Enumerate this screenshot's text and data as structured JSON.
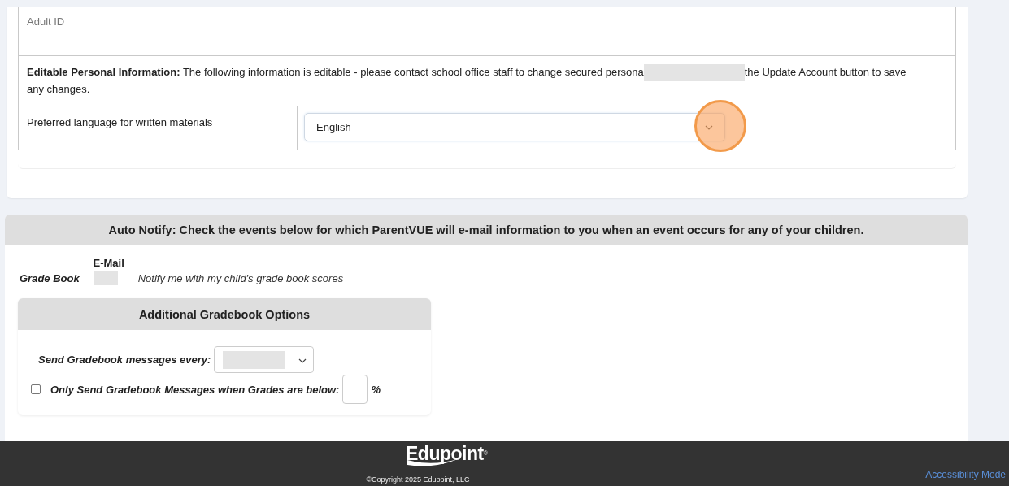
{
  "account_info": {
    "adult_id_label": "Adult ID",
    "editable_note": {
      "label": "Editable Personal Information:",
      "text_before": " The following information is editable - please contact school office staff to change secured persona",
      "redacted": true,
      "text_after": "the Update Account button to save any changes."
    },
    "language": {
      "label": "Preferred language for written materials",
      "value": "English",
      "click_highlight": true
    }
  },
  "auto_notify": {
    "header": "Auto Notify: Check the events below for which ParentVUE will e-mail information to you when an event occurs for any of your children.",
    "column_heading": "E-Mail",
    "events": [
      {
        "label": "Grade Book",
        "redacted": true,
        "description": "Notify me with my child's grade book scores"
      }
    ],
    "gradebook_options": {
      "title": "Additional Gradebook Options",
      "frequency_label": "Send Gradebook messages every:",
      "frequency_redacted": true,
      "threshold_label": "Only Send Gradebook Messages when Grades are below:",
      "threshold_checked": false,
      "percent_sign": "%"
    }
  },
  "footer": {
    "logo": "Edupoint",
    "logo_mark": "®",
    "copyright": "©Copyright 2025 Edupoint, LLC",
    "link": "Accessibility Mode"
  }
}
